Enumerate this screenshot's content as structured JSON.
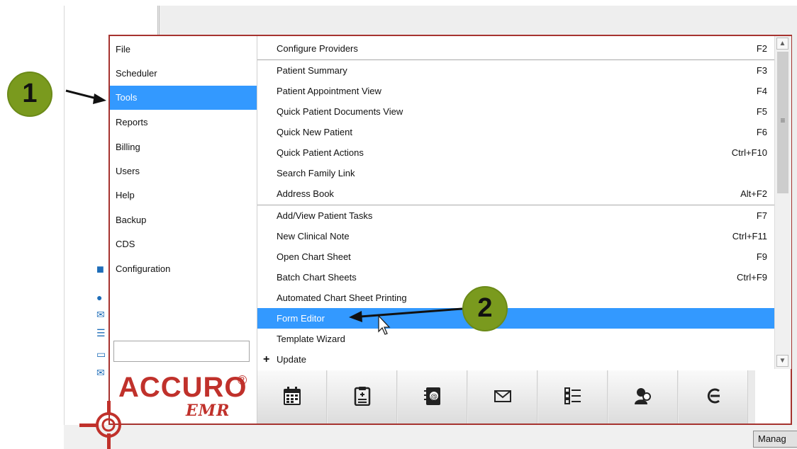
{
  "background": {
    "manage_button": "Manag"
  },
  "menu": {
    "categories": [
      {
        "label": "File"
      },
      {
        "label": "Scheduler"
      },
      {
        "label": "Tools"
      },
      {
        "label": "Reports"
      },
      {
        "label": "Billing"
      },
      {
        "label": "Users"
      },
      {
        "label": "Help"
      },
      {
        "label": "Backup"
      },
      {
        "label": "CDS"
      },
      {
        "label": "Configuration"
      }
    ],
    "selected_category": "Tools",
    "items": [
      {
        "label": "Configure Providers",
        "shortcut": "F2"
      },
      {
        "label": "Patient Summary",
        "shortcut": "F3"
      },
      {
        "label": "Patient Appointment View",
        "shortcut": "F4"
      },
      {
        "label": "Quick Patient Documents View",
        "shortcut": "F5"
      },
      {
        "label": "Quick New Patient",
        "shortcut": "F6"
      },
      {
        "label": "Quick Patient Actions",
        "shortcut": "Ctrl+F10"
      },
      {
        "label": "Search Family Link",
        "shortcut": ""
      },
      {
        "label": "Address Book",
        "shortcut": "Alt+F2"
      },
      {
        "label": "Add/View Patient Tasks",
        "shortcut": "F7"
      },
      {
        "label": "New Clinical Note",
        "shortcut": "Ctrl+F11"
      },
      {
        "label": "Open Chart Sheet",
        "shortcut": "F9"
      },
      {
        "label": "Batch Chart Sheets",
        "shortcut": "Ctrl+F9"
      },
      {
        "label": "Automated Chart Sheet Printing",
        "shortcut": ""
      },
      {
        "label": "Form Editor",
        "shortcut": ""
      },
      {
        "label": "Template Wizard",
        "shortcut": ""
      },
      {
        "label": "Update",
        "shortcut": ""
      }
    ],
    "selected_item": "Form Editor",
    "update_prefix": "+"
  },
  "logo": {
    "brand": "ACCURO",
    "registered": "®",
    "product": "EMR"
  },
  "toolbar_icons": [
    "calendar-icon",
    "clipboard-icon",
    "address-book-icon",
    "envelope-icon",
    "task-list-icon",
    "user-search-icon",
    "logout-icon"
  ],
  "annotations": {
    "step1": "1",
    "step2": "2"
  },
  "colors": {
    "selection": "#3399ff",
    "frame": "#a6332f",
    "brand": "#c0312b",
    "badge": "#7a9a1e"
  }
}
